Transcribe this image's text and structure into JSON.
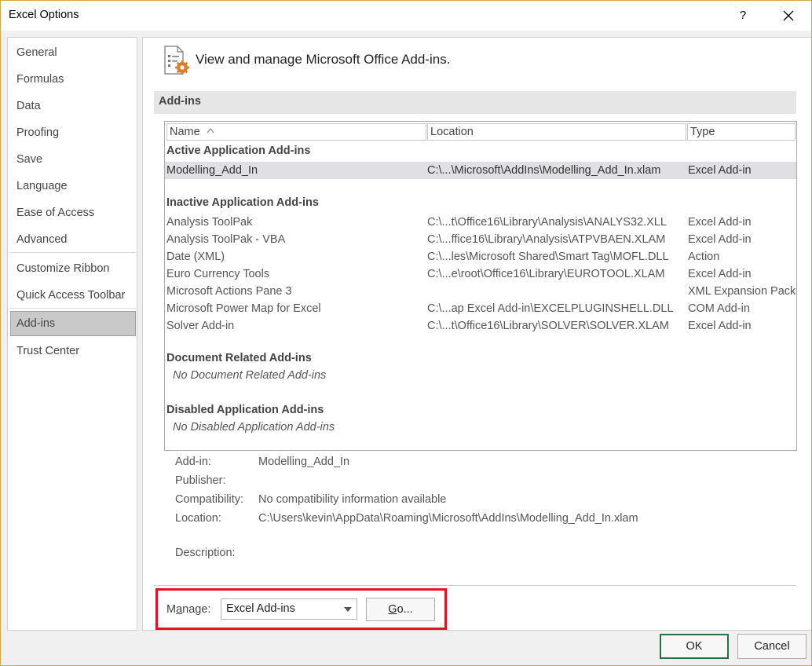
{
  "window": {
    "title": "Excel Options",
    "help_label": "?"
  },
  "sidebar": {
    "items": [
      {
        "label": "General"
      },
      {
        "label": "Formulas"
      },
      {
        "label": "Data"
      },
      {
        "label": "Proofing"
      },
      {
        "label": "Save"
      },
      {
        "label": "Language"
      },
      {
        "label": "Ease of Access"
      },
      {
        "label": "Advanced"
      },
      {
        "label": "Customize Ribbon"
      },
      {
        "label": "Quick Access Toolbar"
      },
      {
        "label": "Add-ins",
        "selected": true
      },
      {
        "label": "Trust Center"
      }
    ]
  },
  "main": {
    "header_text": "View and manage Microsoft Office Add-ins.",
    "section_title": "Add-ins",
    "columns": {
      "name": "Name",
      "location": "Location",
      "type": "Type"
    },
    "groups": {
      "active": {
        "title": "Active Application Add-ins",
        "rows": [
          {
            "name": "Modelling_Add_In",
            "location": "C:\\...\\Microsoft\\AddIns\\Modelling_Add_In.xlam",
            "type": "Excel Add-in"
          }
        ]
      },
      "inactive": {
        "title": "Inactive Application Add-ins",
        "rows": [
          {
            "name": "Analysis ToolPak",
            "location": "C:\\...t\\Office16\\Library\\Analysis\\ANALYS32.XLL",
            "type": "Excel Add-in"
          },
          {
            "name": "Analysis ToolPak - VBA",
            "location": "C:\\...ffice16\\Library\\Analysis\\ATPVBAEN.XLAM",
            "type": "Excel Add-in"
          },
          {
            "name": "Date (XML)",
            "location": "C:\\...les\\Microsoft Shared\\Smart Tag\\MOFL.DLL",
            "type": "Action"
          },
          {
            "name": "Euro Currency Tools",
            "location": "C:\\...e\\root\\Office16\\Library\\EUROTOOL.XLAM",
            "type": "Excel Add-in"
          },
          {
            "name": "Microsoft Actions Pane 3",
            "location": "",
            "type": "XML Expansion Pack"
          },
          {
            "name": "Microsoft Power Map for Excel",
            "location": "C:\\...ap Excel Add-in\\EXCELPLUGINSHELL.DLL",
            "type": "COM Add-in"
          },
          {
            "name": "Solver Add-in",
            "location": "C:\\...t\\Office16\\Library\\SOLVER\\SOLVER.XLAM",
            "type": "Excel Add-in"
          }
        ]
      },
      "document": {
        "title": "Document Related Add-ins",
        "empty": "No Document Related Add-ins"
      },
      "disabled": {
        "title": "Disabled Application Add-ins",
        "empty": "No Disabled Application Add-ins"
      }
    },
    "details": {
      "addin_label": "Add-in:",
      "addin_value": "Modelling_Add_In",
      "publisher_label": "Publisher:",
      "publisher_value": "",
      "compat_label": "Compatibility:",
      "compat_value": "No compatibility information available",
      "location_label": "Location:",
      "location_value": "C:\\Users\\kevin\\AppData\\Roaming\\Microsoft\\AddIns\\Modelling_Add_In.xlam",
      "description_label": "Description:",
      "description_value": ""
    },
    "manage": {
      "label_pre": "M",
      "label_ul": "a",
      "label_post": "nage:",
      "selected": "Excel Add-ins",
      "go_ul": "G",
      "go_post": "o..."
    }
  },
  "footer": {
    "ok": "OK",
    "cancel": "Cancel"
  },
  "colors": {
    "window_border": "#d7a64a",
    "selected_nav": "#c9c9c9",
    "highlight_box": "#e81123",
    "ok_border": "#217346"
  }
}
